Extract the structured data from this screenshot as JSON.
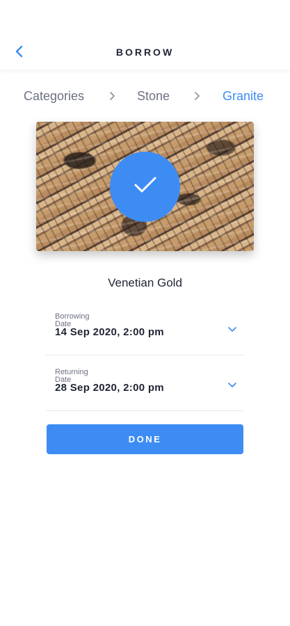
{
  "header": {
    "title": "BORROW",
    "back_icon": "chevron-left-icon"
  },
  "breadcrumb": {
    "items": [
      "Categories",
      "Stone",
      "Granite"
    ],
    "active_index": 2,
    "separator_icon": "chevron-right-icon"
  },
  "product": {
    "name": "Venetian Gold",
    "selected_icon": "checkmark-icon"
  },
  "form": {
    "borrowing": {
      "label": "Borrowing Date",
      "value": "14 Sep 2020, 2:00 pm"
    },
    "returning": {
      "label": "Returning Date",
      "value": "28 Sep 2020, 2:00 pm"
    },
    "dropdown_icon": "chevron-down-icon"
  },
  "actions": {
    "done_label": "DONE"
  },
  "colors": {
    "accent": "#3d8cf4",
    "text_primary": "#1f2433",
    "text_secondary": "#6c7182",
    "background": "#ffffff"
  }
}
